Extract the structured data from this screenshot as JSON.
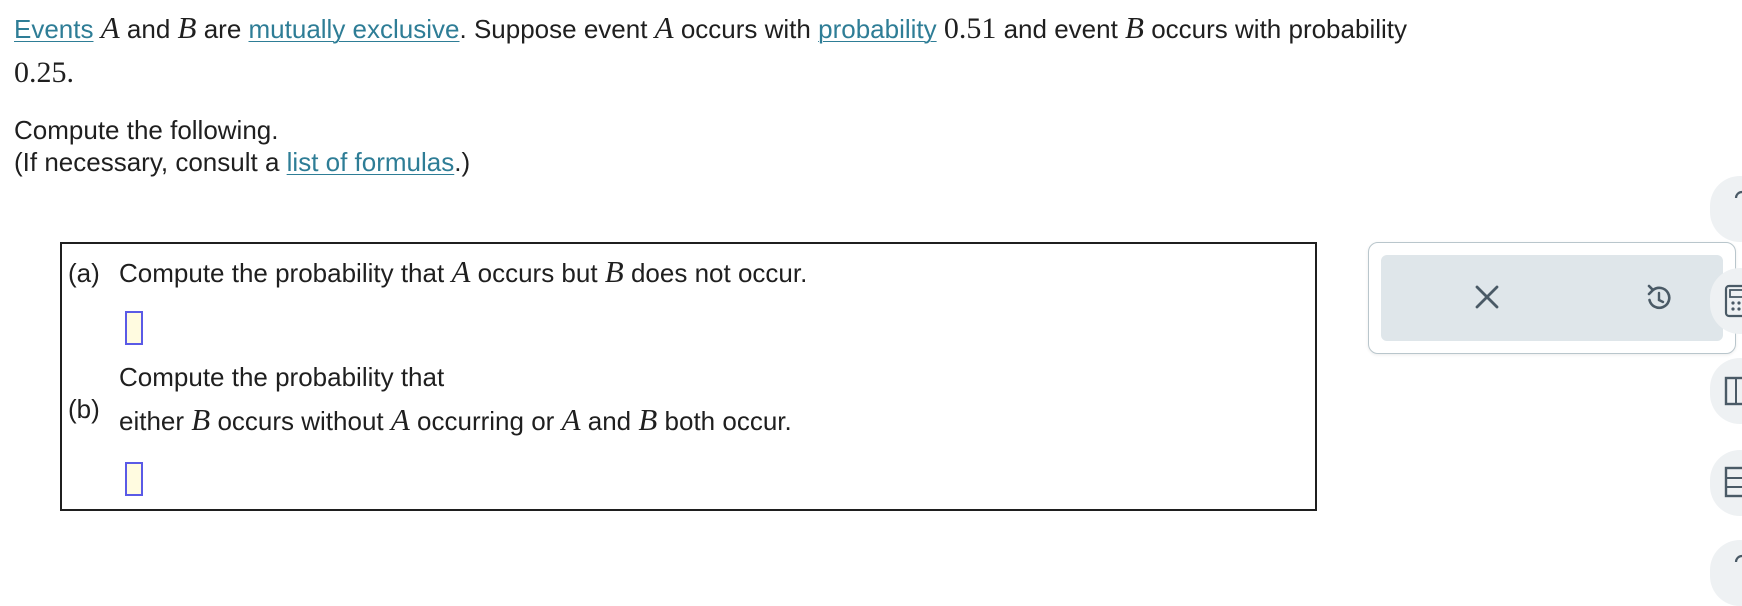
{
  "intro": {
    "events_link": "Events",
    "var_a": "A",
    "and": "and",
    "var_b": "B",
    "are": "are",
    "mutex_link": "mutually exclusive",
    "suppose": ". Suppose event",
    "occurs_with": "occurs with",
    "prob_link": "probability",
    "prob_a": "0.51",
    "and_event": "and event",
    "occurs_with_prob": "occurs with probability",
    "prob_b": "0.25."
  },
  "instructions": {
    "line1": "Compute the following.",
    "line2_pre": "(If necessary, consult a ",
    "formulas_link": "list of formulas",
    "line2_post": ".)"
  },
  "part_a": {
    "label": "(a)",
    "text_1": "Compute the probability that",
    "var_a": "A",
    "text_2": "occurs but",
    "var_b": "B",
    "text_3": "does not occur.",
    "answer": ""
  },
  "part_b": {
    "label": "(b)",
    "line1": "Compute the probability that",
    "text_1": "either",
    "var_b": "B",
    "text_2": "occurs without",
    "var_a": "A",
    "text_3": "occurring or",
    "var_a2": "A",
    "text_4": "and",
    "var_b2": "B",
    "text_5": "both occur.",
    "answer": ""
  },
  "actions": {
    "clear_icon": "close-icon",
    "undo_icon": "undo-icon"
  },
  "colors": {
    "link": "#2e7d96",
    "answer_border": "#5a5ae6",
    "panel_bg": "#dfe6ea"
  }
}
